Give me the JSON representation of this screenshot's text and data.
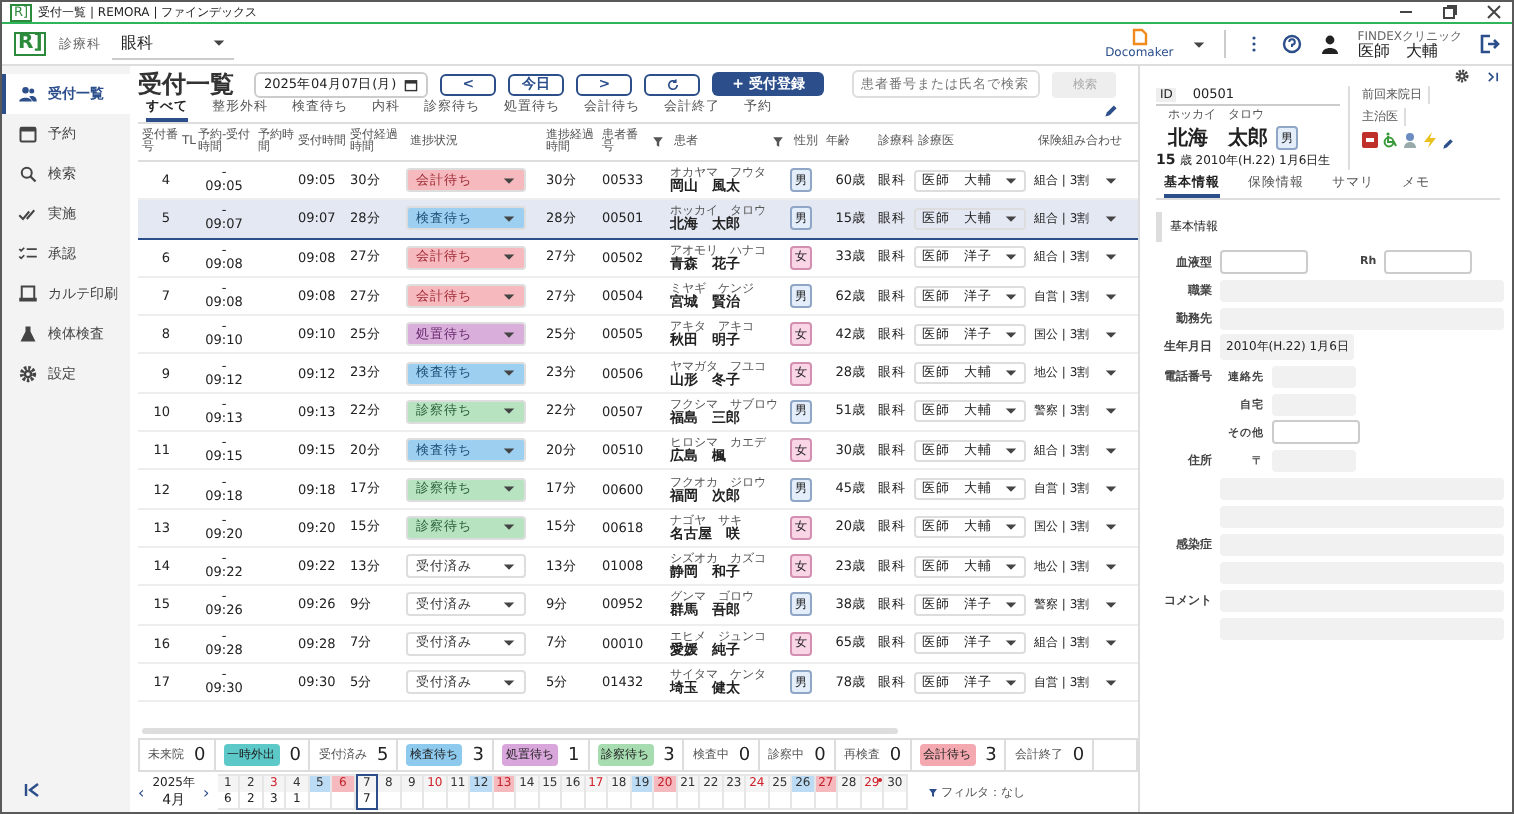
{
  "window": {
    "logo": "R]",
    "title": "受付一覧 | REMORA | ファインデックス"
  },
  "toolbar": {
    "logo": "R]",
    "department_label": "診療科",
    "department": "眼科",
    "app": "Docomaker",
    "clinic": "FINDEXクリニック",
    "user": "医師　大輔"
  },
  "sidebar": {
    "items": [
      {
        "label": "受付一覧",
        "kind": "people",
        "selected": true
      },
      {
        "label": "予約",
        "kind": "calendar",
        "selected": false
      },
      {
        "label": "検索",
        "kind": "search",
        "selected": false
      },
      {
        "label": "実施",
        "kind": "check",
        "selected": false
      },
      {
        "label": "承認",
        "kind": "checklist",
        "selected": false
      },
      {
        "label": "カルテ印刷",
        "kind": "print",
        "selected": false
      },
      {
        "label": "検体検査",
        "kind": "flask",
        "selected": false
      },
      {
        "label": "設定",
        "kind": "gear",
        "selected": false
      }
    ]
  },
  "header": {
    "title": "受付一覧",
    "date": "2025年04月07日(月)",
    "prev": "<",
    "today": "今日",
    "next": ">",
    "register": "+ 受付登録",
    "search": {
      "placeholder": "患者番号または氏名で検索"
    },
    "search_button": {
      "label": "検索",
      "disabled": true
    }
  },
  "tabs": [
    {
      "label": "すべて",
      "selected": true
    },
    {
      "label": "整形外科",
      "selected": false
    },
    {
      "label": "検査待ち",
      "selected": false
    },
    {
      "label": "内科",
      "selected": false
    },
    {
      "label": "診察待ち",
      "selected": false
    },
    {
      "label": "処置待ち",
      "selected": false
    },
    {
      "label": "会計待ち",
      "selected": false
    },
    {
      "label": "会計終了",
      "selected": false
    },
    {
      "label": "予約",
      "selected": false
    }
  ],
  "table": {
    "columns": [
      {
        "label": "受付番号",
        "filter": false
      },
      {
        "label": "TL",
        "filter": false
      },
      {
        "label": "予約-受付時間",
        "filter": false
      },
      {
        "label": "予約時間",
        "filter": false
      },
      {
        "label": "受付時間",
        "filter": false
      },
      {
        "label": "受付経過時間",
        "filter": false
      },
      {
        "label": "進捗状況",
        "filter": false
      },
      {
        "label": "進捗経過時間",
        "filter": false
      },
      {
        "label": "患者番号",
        "filter": true
      },
      {
        "label": "患者",
        "filter": true
      },
      {
        "label": "性別",
        "filter": false
      },
      {
        "label": "年齢",
        "filter": false
      },
      {
        "label": "診療科",
        "filter": false
      },
      {
        "label": "診療医",
        "filter": false
      },
      {
        "label": "保険組み合わせ",
        "filter": false
      }
    ],
    "rows": [
      {
        "no": "4",
        "reserve": "-",
        "reception": "09:05",
        "time": "09:05",
        "elapsed": "30分",
        "status": {
          "label": "会計待ち",
          "kind": "accounting"
        },
        "status_elapsed": "30分",
        "patient_no": "00533",
        "kana": "オカヤマ　フウタ",
        "name": "岡山　風太",
        "sex": {
          "label": "男",
          "kind": "male"
        },
        "age": "60歳",
        "dept": "眼科",
        "doctor": "医師　大輔",
        "insurance": "組合 | 3割",
        "selected": false
      },
      {
        "no": "5",
        "reserve": "-",
        "reception": "09:07",
        "time": "09:07",
        "elapsed": "28分",
        "status": {
          "label": "検査待ち",
          "kind": "exam"
        },
        "status_elapsed": "28分",
        "patient_no": "00501",
        "kana": "ホッカイ　タロウ",
        "name": "北海　太郎",
        "sex": {
          "label": "男",
          "kind": "male"
        },
        "age": "15歳",
        "dept": "眼科",
        "doctor": "医師　大輔",
        "insurance": "組合 | 3割",
        "selected": true
      },
      {
        "no": "6",
        "reserve": "-",
        "reception": "09:08",
        "time": "09:08",
        "elapsed": "27分",
        "status": {
          "label": "会計待ち",
          "kind": "accounting"
        },
        "status_elapsed": "27分",
        "patient_no": "00502",
        "kana": "アオモリ　ハナコ",
        "name": "青森　花子",
        "sex": {
          "label": "女",
          "kind": "female"
        },
        "age": "33歳",
        "dept": "眼科",
        "doctor": "医師　洋子",
        "insurance": "組合 | 3割",
        "selected": false
      },
      {
        "no": "7",
        "reserve": "-",
        "reception": "09:08",
        "time": "09:08",
        "elapsed": "27分",
        "status": {
          "label": "会計待ち",
          "kind": "accounting"
        },
        "status_elapsed": "27分",
        "patient_no": "00504",
        "kana": "ミヤギ　ケンジ",
        "name": "宮城　賢治",
        "sex": {
          "label": "男",
          "kind": "male"
        },
        "age": "62歳",
        "dept": "眼科",
        "doctor": "医師　洋子",
        "insurance": "自営 | 3割",
        "selected": false
      },
      {
        "no": "8",
        "reserve": "-",
        "reception": "09:10",
        "time": "09:10",
        "elapsed": "25分",
        "status": {
          "label": "処置待ち",
          "kind": "treatment"
        },
        "status_elapsed": "25分",
        "patient_no": "00505",
        "kana": "アキタ　アキコ",
        "name": "秋田　明子",
        "sex": {
          "label": "女",
          "kind": "female"
        },
        "age": "42歳",
        "dept": "眼科",
        "doctor": "医師　洋子",
        "insurance": "国公 | 3割",
        "selected": false
      },
      {
        "no": "9",
        "reserve": "-",
        "reception": "09:12",
        "time": "09:12",
        "elapsed": "23分",
        "status": {
          "label": "検査待ち",
          "kind": "exam"
        },
        "status_elapsed": "23分",
        "patient_no": "00506",
        "kana": "ヤマガタ　フユコ",
        "name": "山形　冬子",
        "sex": {
          "label": "女",
          "kind": "female"
        },
        "age": "28歳",
        "dept": "眼科",
        "doctor": "医師　大輔",
        "insurance": "地公 | 3割",
        "selected": false
      },
      {
        "no": "10",
        "reserve": "-",
        "reception": "09:13",
        "time": "09:13",
        "elapsed": "22分",
        "status": {
          "label": "診察待ち",
          "kind": "consult"
        },
        "status_elapsed": "22分",
        "patient_no": "00507",
        "kana": "フクシマ　サブロウ",
        "name": "福島　三郎",
        "sex": {
          "label": "男",
          "kind": "male"
        },
        "age": "51歳",
        "dept": "眼科",
        "doctor": "医師　大輔",
        "insurance": "警察 | 3割",
        "selected": false
      },
      {
        "no": "11",
        "reserve": "-",
        "reception": "09:15",
        "time": "09:15",
        "elapsed": "20分",
        "status": {
          "label": "検査待ち",
          "kind": "exam"
        },
        "status_elapsed": "20分",
        "patient_no": "00510",
        "kana": "ヒロシマ　カエデ",
        "name": "広島　楓",
        "sex": {
          "label": "女",
          "kind": "female"
        },
        "age": "30歳",
        "dept": "眼科",
        "doctor": "医師　大輔",
        "insurance": "組合 | 3割",
        "selected": false
      },
      {
        "no": "12",
        "reserve": "-",
        "reception": "09:18",
        "time": "09:18",
        "elapsed": "17分",
        "status": {
          "label": "診察待ち",
          "kind": "consult"
        },
        "status_elapsed": "17分",
        "patient_no": "00600",
        "kana": "フクオカ　ジロウ",
        "name": "福岡　次郎",
        "sex": {
          "label": "男",
          "kind": "male"
        },
        "age": "45歳",
        "dept": "眼科",
        "doctor": "医師　大輔",
        "insurance": "自営 | 3割",
        "selected": false
      },
      {
        "no": "13",
        "reserve": "-",
        "reception": "09:20",
        "time": "09:20",
        "elapsed": "15分",
        "status": {
          "label": "診察待ち",
          "kind": "consult"
        },
        "status_elapsed": "15分",
        "patient_no": "00618",
        "kana": "ナゴヤ　サキ",
        "name": "名古屋　咲",
        "sex": {
          "label": "女",
          "kind": "female"
        },
        "age": "20歳",
        "dept": "眼科",
        "doctor": "医師　大輔",
        "insurance": "国公 | 3割",
        "selected": false
      },
      {
        "no": "14",
        "reserve": "-",
        "reception": "09:22",
        "time": "09:22",
        "elapsed": "13分",
        "status": {
          "label": "受付済み",
          "kind": "received"
        },
        "status_elapsed": "13分",
        "patient_no": "01008",
        "kana": "シズオカ　カズコ",
        "name": "静岡　和子",
        "sex": {
          "label": "女",
          "kind": "female"
        },
        "age": "23歳",
        "dept": "眼科",
        "doctor": "医師　大輔",
        "insurance": "地公 | 3割",
        "selected": false
      },
      {
        "no": "15",
        "reserve": "-",
        "reception": "09:26",
        "time": "09:26",
        "elapsed": "9分",
        "status": {
          "label": "受付済み",
          "kind": "received"
        },
        "status_elapsed": "9分",
        "patient_no": "00952",
        "kana": "グンマ　ゴロウ",
        "name": "群馬　吾郎",
        "sex": {
          "label": "男",
          "kind": "male"
        },
        "age": "38歳",
        "dept": "眼科",
        "doctor": "医師　洋子",
        "insurance": "警察 | 3割",
        "selected": false
      },
      {
        "no": "16",
        "reserve": "-",
        "reception": "09:28",
        "time": "09:28",
        "elapsed": "7分",
        "status": {
          "label": "受付済み",
          "kind": "received"
        },
        "status_elapsed": "7分",
        "patient_no": "00010",
        "kana": "エヒメ　ジュンコ",
        "name": "愛媛　純子",
        "sex": {
          "label": "女",
          "kind": "female"
        },
        "age": "65歳",
        "dept": "眼科",
        "doctor": "医師　洋子",
        "insurance": "組合 | 3割",
        "selected": false
      },
      {
        "no": "17",
        "reserve": "-",
        "reception": "09:30",
        "time": "09:30",
        "elapsed": "5分",
        "status": {
          "label": "受付済み",
          "kind": "received"
        },
        "status_elapsed": "5分",
        "patient_no": "01432",
        "kana": "サイタマ　ケンタ",
        "name": "埼玉　健太",
        "sex": {
          "label": "男",
          "kind": "male"
        },
        "age": "78歳",
        "dept": "眼科",
        "doctor": "医師　洋子",
        "insurance": "自営 | 3割",
        "selected": false
      }
    ]
  },
  "summary": [
    {
      "label": "未来院",
      "count": "0",
      "kind": "plain"
    },
    {
      "label": "一時外出",
      "count": "0",
      "kind": "badge",
      "color": "#5cc8c8"
    },
    {
      "label": "受付済み",
      "count": "5",
      "kind": "plain"
    },
    {
      "label": "検査待ち",
      "count": "3",
      "kind": "badge",
      "color": "#8ec9ee"
    },
    {
      "label": "処置待ち",
      "count": "1",
      "kind": "badge",
      "color": "#d9a6dc"
    },
    {
      "label": "診察待ち",
      "count": "3",
      "kind": "badge",
      "color": "#a6dcb0"
    },
    {
      "label": "検査中",
      "count": "0",
      "kind": "plain"
    },
    {
      "label": "診察中",
      "count": "0",
      "kind": "plain"
    },
    {
      "label": "再検査",
      "count": "0",
      "kind": "plain"
    },
    {
      "label": "会計待ち",
      "count": "3",
      "kind": "badge",
      "color": "#f4a9b0"
    },
    {
      "label": "会計終了",
      "count": "0",
      "kind": "plain"
    }
  ],
  "calendar": {
    "year": "2025年",
    "month": "4月",
    "prev": "‹",
    "next": "›",
    "filter": "フィルタ：なし",
    "days": [
      {
        "day": "1",
        "count": "6",
        "kind": "weekday",
        "selected": false,
        "marked": false
      },
      {
        "day": "2",
        "count": "2",
        "kind": "weekday",
        "selected": false,
        "marked": false
      },
      {
        "day": "3",
        "count": "3",
        "kind": "closed",
        "selected": false,
        "marked": false
      },
      {
        "day": "4",
        "count": "1",
        "kind": "weekday",
        "selected": false,
        "marked": false
      },
      {
        "day": "5",
        "kind": "saturday",
        "selected": false,
        "marked": false
      },
      {
        "day": "6",
        "kind": "sunday",
        "selected": false,
        "marked": false
      },
      {
        "day": "7",
        "count": "7",
        "kind": "weekday",
        "selected": true,
        "marked": false
      },
      {
        "day": "8",
        "kind": "weekday",
        "selected": false,
        "marked": false
      },
      {
        "day": "9",
        "kind": "weekday",
        "selected": false,
        "marked": false
      },
      {
        "day": "10",
        "kind": "closed",
        "selected": false,
        "marked": false
      },
      {
        "day": "11",
        "kind": "weekday",
        "selected": false,
        "marked": false
      },
      {
        "day": "12",
        "kind": "saturday",
        "selected": false,
        "marked": false
      },
      {
        "day": "13",
        "kind": "sunday",
        "selected": false,
        "marked": false
      },
      {
        "day": "14",
        "kind": "weekday",
        "selected": false,
        "marked": false
      },
      {
        "day": "15",
        "kind": "weekday",
        "selected": false,
        "marked": false
      },
      {
        "day": "16",
        "kind": "weekday",
        "selected": false,
        "marked": false
      },
      {
        "day": "17",
        "kind": "closed",
        "selected": false,
        "marked": false
      },
      {
        "day": "18",
        "kind": "weekday",
        "selected": false,
        "marked": false
      },
      {
        "day": "19",
        "kind": "saturday",
        "selected": false,
        "marked": false
      },
      {
        "day": "20",
        "kind": "sunday",
        "selected": false,
        "marked": false
      },
      {
        "day": "21",
        "kind": "weekday",
        "selected": false,
        "marked": false
      },
      {
        "day": "22",
        "kind": "weekday",
        "selected": false,
        "marked": false
      },
      {
        "day": "23",
        "kind": "weekday",
        "selected": false,
        "marked": false
      },
      {
        "day": "24",
        "kind": "closed",
        "selected": false,
        "marked": false
      },
      {
        "day": "25",
        "kind": "weekday",
        "selected": false,
        "marked": false
      },
      {
        "day": "26",
        "kind": "saturday",
        "selected": false,
        "marked": false
      },
      {
        "day": "27",
        "kind": "sunday",
        "selected": false,
        "marked": false
      },
      {
        "day": "28",
        "kind": "weekday",
        "selected": false,
        "marked": false
      },
      {
        "day": "29",
        "kind": "closed",
        "selected": false,
        "marked": true
      },
      {
        "day": "30",
        "kind": "weekday",
        "selected": false,
        "marked": false
      }
    ]
  },
  "patient": {
    "id_label": "ID",
    "id": "00501",
    "kana": "ホッカイ　タロウ",
    "name": "北海　太郎",
    "sex": "男",
    "age": "15",
    "age_unit": "歳",
    "birth": "2010年(H.22) 1月6日生",
    "last_visit_label": "前回来院日",
    "doctor_label": "主治医"
  },
  "detail_tabs": [
    {
      "label": "基本情報",
      "selected": true
    },
    {
      "label": "保険情報",
      "selected": false
    },
    {
      "label": "サマリ",
      "selected": false
    },
    {
      "label": "メモ",
      "selected": false
    }
  ],
  "detail": {
    "section": "基本情報",
    "rows": [
      {
        "label": "血液型",
        "fields": [
          {
            "kind": "input"
          },
          {
            "label": "Rh",
            "kind": "input"
          }
        ]
      },
      {
        "label": "職業",
        "fields": [
          {
            "kind": "readonly"
          }
        ]
      },
      {
        "label": "勤務先",
        "fields": [
          {
            "kind": "readonly"
          }
        ]
      },
      {
        "label": "生年月日",
        "fields": [
          {
            "kind": "value",
            "value": "2010年(H.22) 1月6日"
          }
        ]
      },
      {
        "label": "電話番号",
        "fields": [
          {
            "label": "連絡先",
            "kind": "short_readonly"
          }
        ]
      },
      {
        "fields": [
          {
            "label": "自宅",
            "kind": "short_readonly"
          }
        ]
      },
      {
        "fields": [
          {
            "label": "その他",
            "kind": "input"
          }
        ]
      },
      {
        "label": "住所",
        "fields": [
          {
            "label": "〒",
            "kind": "short_readonly"
          }
        ]
      },
      {
        "fields": [
          {
            "kind": "readonly"
          }
        ]
      },
      {
        "fields": [
          {
            "kind": "readonly"
          }
        ]
      },
      {
        "label": "感染症",
        "fields": [
          {
            "kind": "readonly"
          }
        ]
      },
      {
        "fields": [
          {
            "kind": "readonly"
          }
        ]
      },
      {
        "label": "コメント",
        "fields": [
          {
            "kind": "readonly"
          }
        ]
      },
      {
        "fields": [
          {
            "kind": "readonly"
          }
        ]
      }
    ]
  }
}
